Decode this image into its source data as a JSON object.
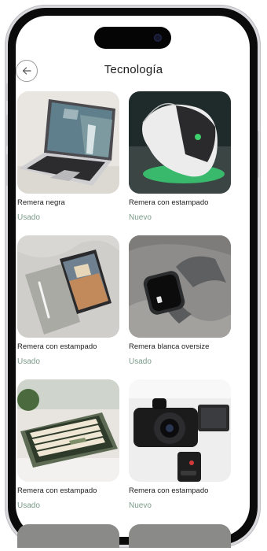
{
  "header": {
    "title": "Tecnología",
    "back_icon": "arrow-left-icon"
  },
  "products": [
    {
      "name": "Remera negra",
      "condition": "Usado",
      "image": "laptop-photo"
    },
    {
      "name": "Remera con estampado",
      "condition": "Nuevo",
      "image": "gaming-mouse-photo"
    },
    {
      "name": "Remera con estampado",
      "condition": "Usado",
      "image": "tablet-photo"
    },
    {
      "name": "Remera blanca oversize",
      "condition": "Usado",
      "image": "smartwatch-photo"
    },
    {
      "name": "Remera con estampado",
      "condition": "Usado",
      "image": "keyboard-photo"
    },
    {
      "name": "Remera con estampado",
      "condition": "Nuevo",
      "image": "camera-photo"
    }
  ],
  "colors": {
    "condition_text": "#7a9a88",
    "title_text": "#1c1c1c"
  }
}
